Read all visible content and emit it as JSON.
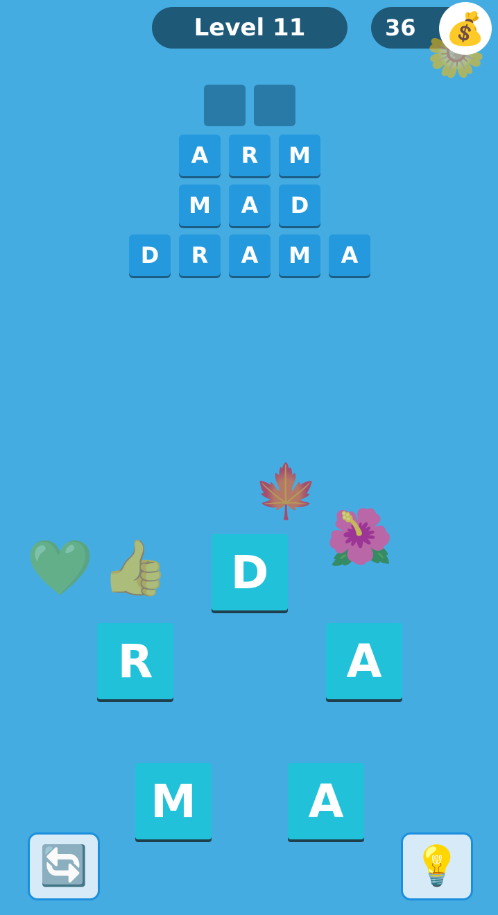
{
  "header": {
    "level_label": "Level 11",
    "coins": "36",
    "coin_icon": "money-bag-icon"
  },
  "board": {
    "hidden_word_length": 2,
    "solved_words": [
      "ARM",
      "MAD",
      "DRAMA"
    ]
  },
  "wheel": {
    "letters": [
      "D",
      "R",
      "A",
      "M",
      "A"
    ]
  },
  "decorations": [
    "green-heart-icon",
    "thumbs-up-icon",
    "maple-leaf-icon",
    "hibiscus-icon",
    "flower-icon"
  ],
  "buttons": {
    "shuffle_icon": "shuffle-icon",
    "hint_icon": "lightbulb-icon"
  },
  "colors": {
    "background": "#45ace2",
    "pill": "#1e5a78",
    "slot_empty": "#2a7aa7",
    "slot_tile": "#2499dd",
    "wheel_tile": "#21c2d9"
  }
}
